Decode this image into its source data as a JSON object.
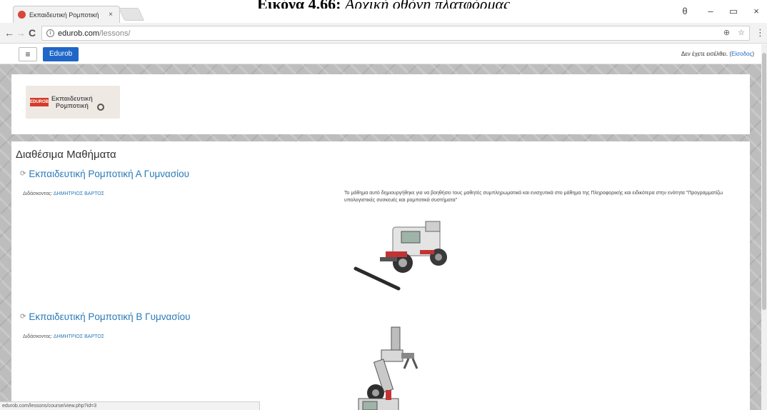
{
  "caption": {
    "bold": "Εικόνα 4.66:",
    "italic": "Αρχική οθόνη πλατφόρμας"
  },
  "browser": {
    "tab_title": "Εκπαιδευτική Ρομποτική",
    "tab_close": "×",
    "url_host": "edurob.com",
    "url_path": "/lessons/",
    "back": "←",
    "forward": "→",
    "reload": "C",
    "zoom_icon": "⊕",
    "star_icon": "☆",
    "menu_icon": "⋮",
    "profile_icon": "θ",
    "minimize": "–",
    "restore": "▭",
    "close": "×"
  },
  "site": {
    "menu_icon": "≡",
    "brand": "Edurob",
    "login_prefix": "Δεν έχετε εισέλθει.",
    "login_open": " (",
    "login_link": "Είσοδος",
    "login_close": ")",
    "logo_mark": "EDUROB",
    "logo_line1": "Εκπαιδευτική",
    "logo_line2": "Ρομποτική"
  },
  "main": {
    "heading": "Διαθέσιμα Μαθήματα",
    "courses": [
      {
        "title": "Εκπαιδευτική Ρομποτική Α Γυμνασίου",
        "teacher_label": "Διδάσκοντας:",
        "teacher_name": "ΔΗΜΗΤΡΙΟΣ ΒΑΡΤΟΣ",
        "summary": "Το μάθημα αυτό δημιουργήθηκε για να βοηθήσει τους μαθητές συμπληρωματικά και ενισχυτικά στο μάθημα της Πληροφορικής και ειδικότερα στην ενότητα \"Προγραμματίζω υπολογιστικές συσκευές και ρομποτικά συστήματα\"",
        "image": "robot-vehicle"
      },
      {
        "title": "Εκπαιδευτική Ρομποτική Β Γυμνασίου",
        "teacher_label": "Διδάσκοντας:",
        "teacher_name": "ΔΗΜΗΤΡΙΟΣ ΒΑΡΤΟΣ",
        "image": "robot-arm"
      }
    ]
  },
  "status_url": "edurob.com/lessons/course/view.php?id=3"
}
